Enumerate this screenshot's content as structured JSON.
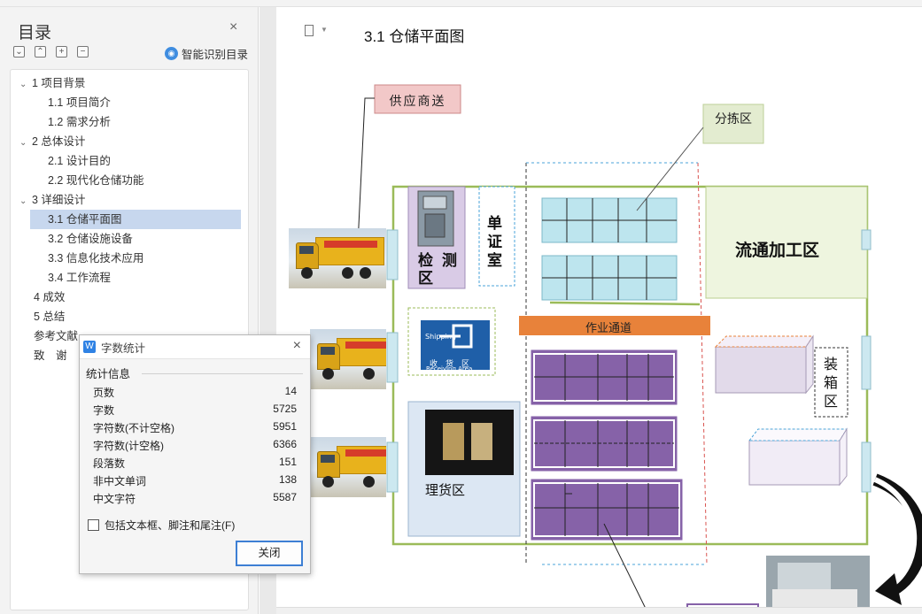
{
  "nav": {
    "title": "目录",
    "close_glyph": "×",
    "tools": [
      "⌄",
      "⌃",
      "+",
      "−"
    ],
    "ai_label": "智能识别目录",
    "toc": [
      {
        "label": "1 项目背景",
        "level": 1,
        "expanded": true
      },
      {
        "label": "1.1 项目简介",
        "level": 2
      },
      {
        "label": "1.2 需求分析",
        "level": 2
      },
      {
        "label": "2 总体设计",
        "level": 1,
        "expanded": true
      },
      {
        "label": "2.1 设计目的",
        "level": 2
      },
      {
        "label": "2.2 现代化仓储功能",
        "level": 2
      },
      {
        "label": "3 详细设计",
        "level": 1,
        "expanded": true
      },
      {
        "label": "3.1 仓储平面图",
        "level": 2,
        "selected": true
      },
      {
        "label": "3.2 仓储设施设备",
        "level": 2
      },
      {
        "label": "3.3 信息化技术应用",
        "level": 2
      },
      {
        "label": "3.4 工作流程",
        "level": 2
      },
      {
        "label": "4 成效",
        "level": 1
      },
      {
        "label": "5 总结",
        "level": 1
      },
      {
        "label": "参考文献",
        "level": 1
      },
      {
        "label": "致　谢",
        "level": 1
      }
    ]
  },
  "dialog": {
    "title": "字数统计",
    "section": "统计信息",
    "stats": [
      {
        "label": "页数",
        "value": "14"
      },
      {
        "label": "字数",
        "value": "5725"
      },
      {
        "label": "字符数(不计空格)",
        "value": "5951"
      },
      {
        "label": "字符数(计空格)",
        "value": "6366"
      },
      {
        "label": "段落数",
        "value": "151"
      },
      {
        "label": "非中文单词",
        "value": "138"
      },
      {
        "label": "中文字符",
        "value": "5587"
      }
    ],
    "checkbox_label": "包括文本框、脚注和尾注(F)",
    "checkbox_checked": false,
    "close_button": "关闭"
  },
  "document": {
    "heading": "3.1 仓储平面图",
    "diagram": {
      "supplier_callout": "供应商送",
      "sorting_callout": "分拣区",
      "inspection_zone": [
        "检",
        "测",
        "区"
      ],
      "voucher_room": [
        "单",
        "证",
        "室"
      ],
      "processing_zone": "流通加工区",
      "work_aisle": "作业通道",
      "receiving_sign_top": "Shipping",
      "receiving_sign_cn": "收　货　区",
      "receiving_sign_en": "Receiving Area",
      "tally_zone": "理货区",
      "boxing_zone": [
        "装",
        "箱",
        "区"
      ]
    }
  },
  "colors": {
    "accent_blue": "#3d7fd4",
    "selected_toc": "#c7d7ee",
    "purple_shelf": "#8662a8",
    "teal_shelf": "#bde5ee",
    "warehouse_border": "#9bbb59",
    "aisle_orange": "#e8823a"
  }
}
